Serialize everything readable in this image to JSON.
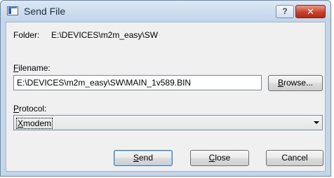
{
  "window": {
    "title": "Send File",
    "help_label": "?",
    "close_label": "✕"
  },
  "folder": {
    "label": "Folder:",
    "path": "E:\\DEVICES\\m2m_easy\\SW"
  },
  "filename": {
    "label_first": "F",
    "label_rest": "ilename:",
    "value": "E:\\DEVICES\\m2m_easy\\SW\\MAIN_1v589.BIN",
    "browse_first": "B",
    "browse_rest": "rowse..."
  },
  "protocol": {
    "label_first": "P",
    "label_rest": "rotocol:",
    "selected_first": "X",
    "selected_rest": "modem"
  },
  "buttons": {
    "send_first": "S",
    "send_rest": "end",
    "close_first": "C",
    "close_rest": "lose",
    "cancel": "Cancel"
  },
  "icons": {
    "app": "send-file-app-icon",
    "dropdown": "chevron-down-icon"
  }
}
